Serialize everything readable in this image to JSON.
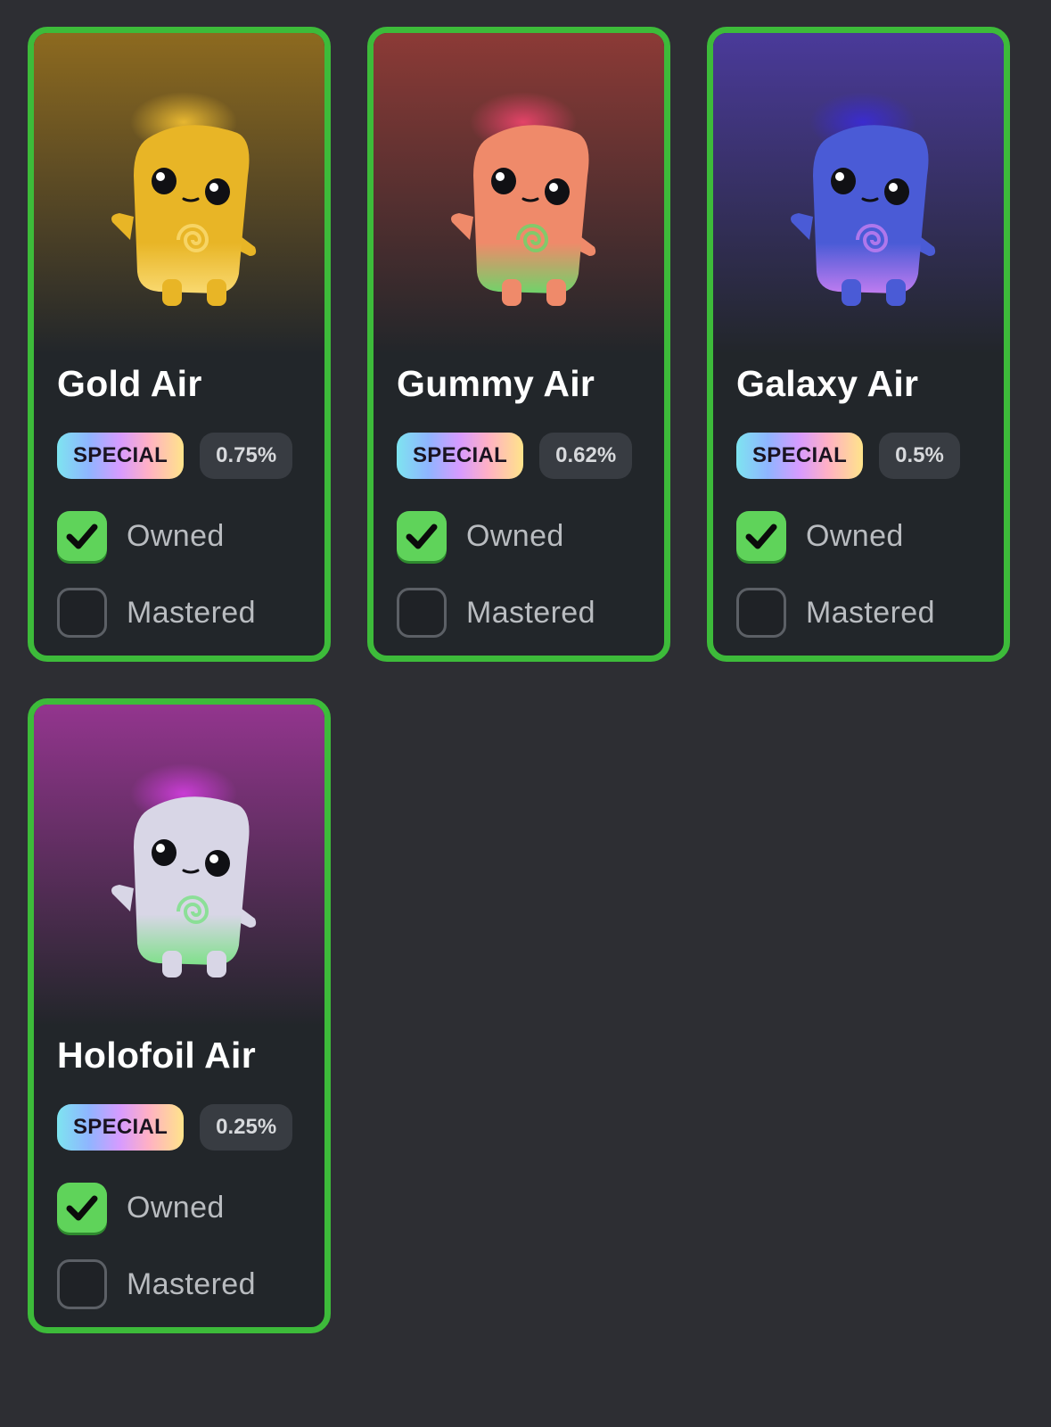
{
  "cards": [
    {
      "name": "Gold Air",
      "badge": "SPECIAL",
      "rarity": "0.75%",
      "owned_label": "Owned",
      "owned": true,
      "mastered_label": "Mastered",
      "mastered": false,
      "theme": {
        "bg_top": "#8d6a1f",
        "body": "#e8b526",
        "glow": "#f5c232",
        "accent": "#f9d970"
      }
    },
    {
      "name": "Gummy Air",
      "badge": "SPECIAL",
      "rarity": "0.62%",
      "owned_label": "Owned",
      "owned": true,
      "mastered_label": "Mastered",
      "mastered": false,
      "theme": {
        "bg_top": "#8c3a36",
        "body": "#ef8a6a",
        "glow": "#f0456e",
        "accent": "#6fd36a"
      }
    },
    {
      "name": "Galaxy Air",
      "badge": "SPECIAL",
      "rarity": "0.5%",
      "owned_label": "Owned",
      "owned": true,
      "mastered_label": "Mastered",
      "mastered": false,
      "theme": {
        "bg_top": "#4a3a9a",
        "body": "#4a5bd6",
        "glow": "#3a2bd8",
        "accent": "#c07cf0"
      }
    },
    {
      "name": "Holofoil Air",
      "badge": "SPECIAL",
      "rarity": "0.25%",
      "owned_label": "Owned",
      "owned": true,
      "mastered_label": "Mastered",
      "mastered": false,
      "theme": {
        "bg_top": "#93358e",
        "body": "#d8d6e6",
        "glow": "#d33ee0",
        "accent": "#7fe08a"
      }
    }
  ]
}
